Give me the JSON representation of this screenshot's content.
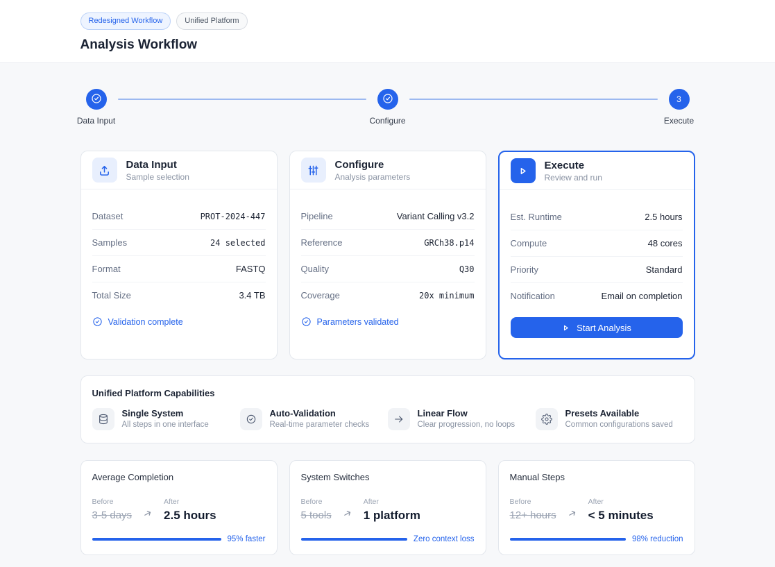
{
  "header": {
    "badge_primary": "Redesigned Workflow",
    "badge_secondary": "Unified Platform",
    "title": "Analysis Workflow"
  },
  "colors": {
    "accent": "#2563eb",
    "accent_light_bg": "#e8effd",
    "stepper_line": "#9db9f0",
    "page_bg": "#f7f8fa"
  },
  "stepper": {
    "steps": [
      {
        "label": "Data Input",
        "state": "complete",
        "glyph": "check-circle"
      },
      {
        "label": "Configure",
        "state": "complete",
        "glyph": "check-circle"
      },
      {
        "label": "Execute",
        "state": "current",
        "number": "3"
      }
    ]
  },
  "cards": [
    {
      "title": "Data Input",
      "subtitle": "Sample selection",
      "icon": "upload-icon",
      "rows": [
        {
          "label": "Dataset",
          "value": "PROT-2024-447"
        },
        {
          "label": "Samples",
          "value": "24 selected"
        },
        {
          "label": "Format",
          "value": "FASTQ"
        },
        {
          "label": "Total Size",
          "value": "3.4 TB"
        }
      ],
      "status_label": "Validation complete"
    },
    {
      "title": "Configure",
      "subtitle": "Analysis parameters",
      "icon": "sliders-icon",
      "rows": [
        {
          "label": "Pipeline",
          "value": "Variant Calling v3.2"
        },
        {
          "label": "Reference",
          "value": "GRCh38.p14"
        },
        {
          "label": "Quality",
          "value": "Q30"
        },
        {
          "label": "Coverage",
          "value": "20x minimum"
        }
      ],
      "status_label": "Parameters validated"
    },
    {
      "title": "Execute",
      "subtitle": "Review and run",
      "icon": "play-icon",
      "rows": [
        {
          "label": "Est. Runtime",
          "value": "2.5 hours"
        },
        {
          "label": "Compute",
          "value": "48 cores"
        },
        {
          "label": "Priority",
          "value": "Standard"
        },
        {
          "label": "Notification",
          "value": "Email on completion"
        }
      ],
      "button_label": "Start Analysis"
    }
  ],
  "capabilities": {
    "title": "Unified Platform Capabilities",
    "items": [
      {
        "icon": "database-icon",
        "title": "Single System",
        "subtitle": "All steps in one interface"
      },
      {
        "icon": "check-circle-icon",
        "title": "Auto-Validation",
        "subtitle": "Real-time parameter checks"
      },
      {
        "icon": "arrow-right-icon",
        "title": "Linear Flow",
        "subtitle": "Clear progression, no loops"
      },
      {
        "icon": "gear-icon",
        "title": "Presets Available",
        "subtitle": "Common configurations saved"
      }
    ]
  },
  "metrics": [
    {
      "title": "Average Completion",
      "before_label": "Before",
      "after_label": "After",
      "before": "3-5 days",
      "after": "2.5 hours",
      "bar_label": "95% faster"
    },
    {
      "title": "System Switches",
      "before_label": "Before",
      "after_label": "After",
      "before": "5 tools",
      "after": "1 platform",
      "bar_label": "Zero context loss"
    },
    {
      "title": "Manual Steps",
      "before_label": "Before",
      "after_label": "After",
      "before": "12+ hours",
      "after": "< 5 minutes",
      "bar_label": "98% reduction"
    }
  ]
}
